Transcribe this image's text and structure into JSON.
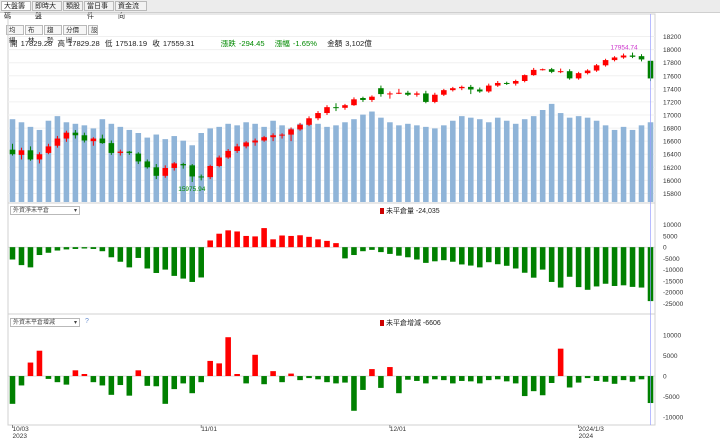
{
  "tabs": [
    "大盤籌碼",
    "即時大盤",
    "類股",
    "當日事件",
    "資金流向"
  ],
  "tools": [
    "均線",
    "布林",
    "趨勢",
    "分價圖",
    "設"
  ],
  "ohlc": {
    "open_label": "開",
    "open": "17829.28",
    "high_label": "高",
    "high": "17829.28",
    "low_label": "低",
    "low": "17518.19",
    "close_label": "收",
    "close": "17559.31",
    "change_label": "漲跌",
    "change": "-294.45",
    "pct_label": "漲幅",
    "pct": "-1.65%",
    "amount_label": "金額",
    "amount": "3,102億"
  },
  "lower1": {
    "selector": "外資淨未平倉",
    "label": "未平倉量",
    "value": "-24,035"
  },
  "lower2": {
    "selector": "外資未平倉增減",
    "label": "未平倉增減",
    "value": "-6606",
    "help": "?"
  },
  "chart_data": [
    {
      "type": "candlestick",
      "panel": "price",
      "ylim": [
        15700,
        18300
      ],
      "yticks": [
        15800,
        16000,
        16200,
        16400,
        16600,
        16800,
        17000,
        17200,
        17400,
        17600,
        17800,
        18000,
        18200
      ],
      "annotations": [
        {
          "text": "17954.74",
          "color": "#cc33cc"
        },
        {
          "text": "15975.94",
          "color": "#008a00"
        }
      ],
      "xticks": [
        {
          "label": "10/03",
          "sub": "2023",
          "index": 0
        },
        {
          "label": "11/01",
          "index": 21
        },
        {
          "label": "12/01",
          "index": 42
        },
        {
          "label": "2024/1/3",
          "sub": "2024",
          "index": 63
        }
      ],
      "colors": {
        "up": "#ff0000",
        "down": "#008000",
        "volume": "#8fb4d8"
      },
      "ohlc": [
        [
          16470,
          16560,
          16380,
          16400
        ],
        [
          16390,
          16500,
          16320,
          16460
        ],
        [
          16460,
          16520,
          16300,
          16320
        ],
        [
          16320,
          16430,
          16260,
          16400
        ],
        [
          16420,
          16560,
          16400,
          16520
        ],
        [
          16530,
          16680,
          16500,
          16640
        ],
        [
          16640,
          16760,
          16590,
          16730
        ],
        [
          16730,
          16770,
          16640,
          16690
        ],
        [
          16690,
          16730,
          16580,
          16610
        ],
        [
          16600,
          16660,
          16530,
          16640
        ],
        [
          16640,
          16700,
          16560,
          16570
        ],
        [
          16570,
          16610,
          16390,
          16420
        ],
        [
          16420,
          16470,
          16380,
          16440
        ],
        [
          16440,
          16450,
          16390,
          16420
        ],
        [
          16410,
          16430,
          16250,
          16290
        ],
        [
          16290,
          16320,
          16180,
          16200
        ],
        [
          16200,
          16250,
          16020,
          16070
        ],
        [
          16070,
          16230,
          16040,
          16190
        ],
        [
          16190,
          16280,
          16150,
          16260
        ],
        [
          16250,
          16270,
          16180,
          16230
        ],
        [
          16230,
          16250,
          15976,
          16060
        ],
        [
          16060,
          16090,
          16000,
          16050
        ],
        [
          16050,
          16240,
          16020,
          16220
        ],
        [
          16220,
          16380,
          16200,
          16350
        ],
        [
          16350,
          16480,
          16330,
          16450
        ],
        [
          16450,
          16560,
          16420,
          16520
        ],
        [
          16520,
          16600,
          16490,
          16580
        ],
        [
          16580,
          16640,
          16530,
          16610
        ],
        [
          16610,
          16680,
          16590,
          16660
        ],
        [
          16660,
          16720,
          16600,
          16690
        ],
        [
          16690,
          16720,
          16640,
          16700
        ],
        [
          16700,
          16810,
          16600,
          16780
        ],
        [
          16780,
          16880,
          16760,
          16850
        ],
        [
          16850,
          16980,
          16830,
          16950
        ],
        [
          16950,
          17060,
          16920,
          17030
        ],
        [
          17030,
          17150,
          17000,
          17120
        ],
        [
          17120,
          17180,
          17060,
          17110
        ],
        [
          17110,
          17170,
          17080,
          17150
        ],
        [
          17150,
          17270,
          17140,
          17240
        ],
        [
          17260,
          17280,
          17200,
          17230
        ],
        [
          17230,
          17300,
          17200,
          17280
        ],
        [
          17410,
          17450,
          17280,
          17320
        ],
        [
          17320,
          17360,
          17250,
          17330
        ],
        [
          17330,
          17400,
          17320,
          17340
        ],
        [
          17340,
          17370,
          17290,
          17310
        ],
        [
          17310,
          17360,
          17280,
          17330
        ],
        [
          17330,
          17370,
          17180,
          17200
        ],
        [
          17200,
          17340,
          17180,
          17310
        ],
        [
          17310,
          17400,
          17290,
          17380
        ],
        [
          17380,
          17430,
          17360,
          17410
        ],
        [
          17410,
          17450,
          17380,
          17430
        ],
        [
          17430,
          17460,
          17320,
          17390
        ],
        [
          17390,
          17420,
          17340,
          17360
        ],
        [
          17360,
          17480,
          17340,
          17450
        ],
        [
          17450,
          17520,
          17430,
          17490
        ],
        [
          17490,
          17510,
          17460,
          17480
        ],
        [
          17480,
          17540,
          17450,
          17520
        ],
        [
          17520,
          17620,
          17500,
          17610
        ],
        [
          17610,
          17720,
          17600,
          17690
        ],
        [
          17690,
          17710,
          17680,
          17700
        ],
        [
          17700,
          17720,
          17640,
          17660
        ],
        [
          17660,
          17710,
          17640,
          17670
        ],
        [
          17670,
          17700,
          17540,
          17560
        ],
        [
          17560,
          17660,
          17540,
          17640
        ],
        [
          17640,
          17700,
          17620,
          17680
        ],
        [
          17680,
          17780,
          17660,
          17760
        ],
        [
          17760,
          17860,
          17740,
          17840
        ],
        [
          17840,
          17900,
          17820,
          17880
        ],
        [
          17880,
          17940,
          17860,
          17910
        ],
        [
          17910,
          17955,
          17870,
          17890
        ],
        [
          17900,
          17930,
          17820,
          17850
        ],
        [
          17829.28,
          17829.28,
          17518.19,
          17559.31
        ]
      ],
      "volume_ylim": [
        0,
        3000
      ],
      "volume": [
        2700,
        2600,
        2450,
        2350,
        2650,
        2800,
        2600,
        2550,
        2500,
        2400,
        2700,
        2550,
        2450,
        2350,
        2250,
        2100,
        2200,
        2050,
        2150,
        2000,
        1850,
        2250,
        2400,
        2450,
        2550,
        2500,
        2600,
        2550,
        2450,
        2650,
        2500,
        2400,
        2550,
        2650,
        2550,
        2450,
        2500,
        2600,
        2700,
        2850,
        2950,
        2750,
        2600,
        2500,
        2550,
        2500,
        2450,
        2400,
        2500,
        2650,
        2800,
        2750,
        2700,
        2600,
        2750,
        2650,
        2550,
        2700,
        2800,
        3000,
        3200,
        2900,
        2750,
        2800,
        2750,
        2650,
        2500,
        2350,
        2450,
        2350,
        2500,
        2600
      ]
    },
    {
      "type": "bar",
      "panel": "foreign-net-open-interest",
      "name": "未平倉量",
      "ylim": [
        -28000,
        13000
      ],
      "yticks": [
        10000,
        5000,
        0,
        -5000,
        -10000,
        -15000,
        -20000,
        -25000
      ],
      "values": [
        -5500,
        -8000,
        -9000,
        -3500,
        -2500,
        -1500,
        -1000,
        -800,
        -600,
        -800,
        -1800,
        -4500,
        -6500,
        -9000,
        -4800,
        -9500,
        -11500,
        -10000,
        -12800,
        -14000,
        -15500,
        -13500,
        3000,
        6000,
        7500,
        7000,
        5000,
        4800,
        8500,
        3500,
        5200,
        5000,
        5300,
        4600,
        3500,
        2800,
        1800,
        -5000,
        -3500,
        -1800,
        -1200,
        -2200,
        -3000,
        -3800,
        -4500,
        -5500,
        -7000,
        -6300,
        -5800,
        -6500,
        -7700,
        -8200,
        -9000,
        -6700,
        -7600,
        -8300,
        -9500,
        -11400,
        -13600,
        -10000,
        -15500,
        -18000,
        -13200,
        -17800,
        -19000,
        -17500,
        -16300,
        -17300,
        -17000,
        -17700,
        -18000,
        -24035
      ]
    },
    {
      "type": "bar",
      "panel": "foreign-open-interest-change",
      "name": "未平倉增減",
      "ylim": [
        -11000,
        12000
      ],
      "yticks": [
        10000,
        5000,
        0,
        -5000,
        -10000
      ],
      "values": [
        -6800,
        -2300,
        3300,
        6200,
        -700,
        -1500,
        -2100,
        1400,
        500,
        -1500,
        -2300,
        -4600,
        -2200,
        -4800,
        1400,
        -2400,
        -2500,
        -6800,
        -3200,
        -1800,
        -4200,
        -1500,
        3700,
        3100,
        9500,
        500,
        -1800,
        5200,
        -2000,
        1200,
        -1500,
        600,
        -1000,
        -500,
        -800,
        -1500,
        -1800,
        -1600,
        -8500,
        -3400,
        1700,
        -2900,
        2200,
        -4200,
        -900,
        -1200,
        -1800,
        -800,
        -1000,
        -1800,
        -1200,
        -1300,
        -1800,
        -1000,
        -800,
        -1300,
        -1800,
        -4900,
        -3700,
        -4700,
        -1700,
        6700,
        -2800,
        -1600,
        -500,
        -1200,
        -1400,
        -1900,
        -1000,
        -1400,
        -800,
        -6606
      ]
    }
  ]
}
